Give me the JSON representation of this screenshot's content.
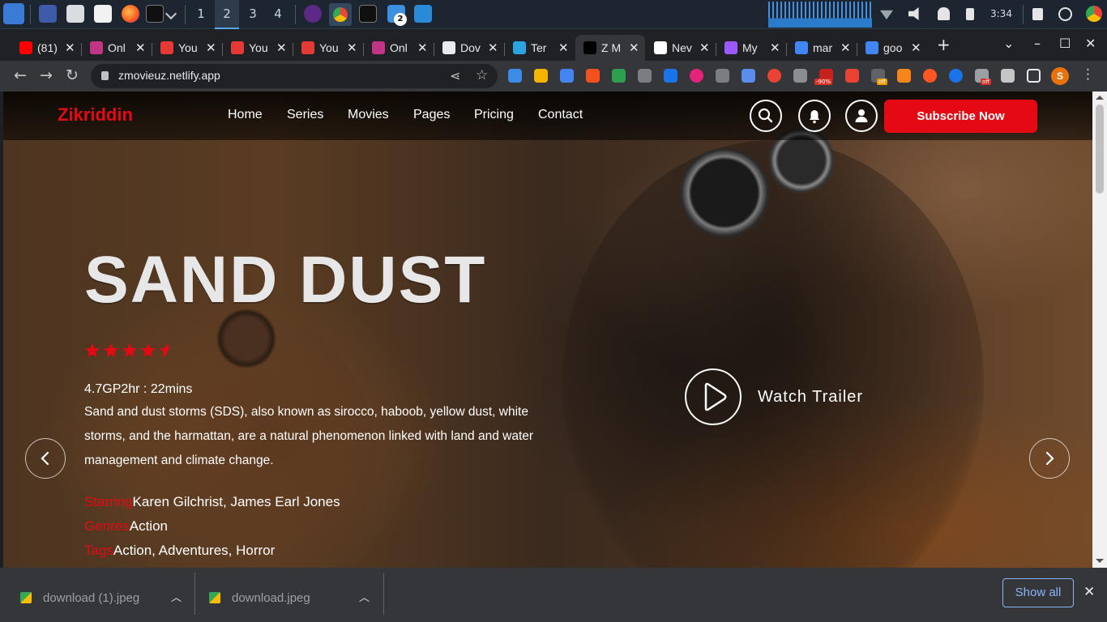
{
  "taskbar": {
    "workspaces": [
      "1",
      "2",
      "3",
      "4"
    ],
    "clock": "3:34",
    "download_badge": "2"
  },
  "tabs": [
    {
      "title": "(81)",
      "favicon": "youtube-icon",
      "color": "#ff0000"
    },
    {
      "title": "Onl",
      "favicon": "play-icon",
      "color": "#c13584"
    },
    {
      "title": "You",
      "favicon": "download-icon",
      "color": "#e53935"
    },
    {
      "title": "You",
      "favicon": "download-icon",
      "color": "#e53935"
    },
    {
      "title": "You",
      "favicon": "download-icon",
      "color": "#e53935"
    },
    {
      "title": "Onl",
      "favicon": "play-icon",
      "color": "#c13584"
    },
    {
      "title": "Dov",
      "favicon": "download-arrow-icon",
      "color": "#e8eaed"
    },
    {
      "title": "Ter",
      "favicon": "telegram-icon",
      "color": "#2aa3df"
    },
    {
      "title": "Z M",
      "favicon": "z-icon",
      "color": "#000000"
    },
    {
      "title": "Nev",
      "favicon": "news-icon",
      "color": "#ffffff"
    },
    {
      "title": "My",
      "favicon": "vite-icon",
      "color": "#9b59ff"
    },
    {
      "title": "mar",
      "favicon": "google-icon",
      "color": "#4285f4"
    },
    {
      "title": "goo",
      "favicon": "google-icon",
      "color": "#4285f4"
    }
  ],
  "toolbar": {
    "url": "zmovieuz.netlify.app",
    "badges": {
      "discount": "-90%",
      "off1": "off",
      "off2": "off"
    },
    "profile_initial": "S"
  },
  "site": {
    "logo": "Zikriddin",
    "nav": [
      "Home",
      "Series",
      "Movies",
      "Pages",
      "Pricing",
      "Contact"
    ],
    "subscribe_label": "Subscribe Now",
    "accent": "#e50914"
  },
  "hero": {
    "title": "SAND DUST",
    "rating_stars": 4.5,
    "meta": "4.7GP2hr : 22mins",
    "description": "Sand and dust storms (SDS), also known as sirocco, haboob, yellow dust, white storms, and the harmattan, are a natural phenomenon linked with land and water management and climate change.",
    "starring_label": "Starring",
    "starring": "Karen Gilchrist, James Earl Jones",
    "genres_label": "Genres",
    "genres": "Action",
    "tags_label": "Tags",
    "tags": "Action, Adventures, Horror",
    "trailer_label": "Watch Trailer"
  },
  "downloads": {
    "items": [
      "download (1).jpeg",
      "download.jpeg"
    ],
    "show_all": "Show all"
  }
}
